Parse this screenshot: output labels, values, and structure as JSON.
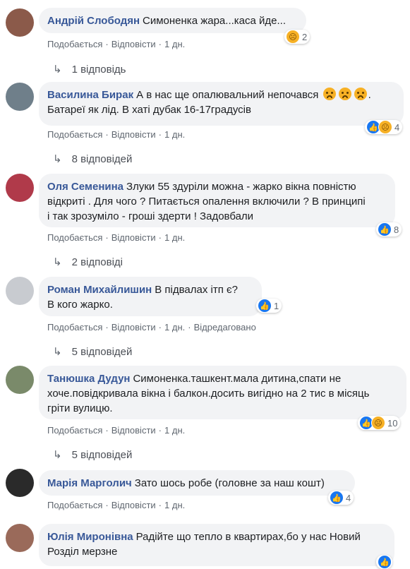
{
  "labels": {
    "like": "Подобається",
    "reply": "Відповісти",
    "edited": "Відредаговано"
  },
  "comments": [
    {
      "author": "Андрій Слободян",
      "text": "Симоненка жара...каса йде...",
      "reactions": "2",
      "time": "1 дн.",
      "replies": "1 відповідь",
      "avatar_color": "#8b5a4a"
    },
    {
      "author": "Василина Бирак",
      "text_line1": "А в нас ще опалювальний непочався",
      "text_line2": "Батареї як лід. В хаті дубак 16-17градусів",
      "reactions": "4",
      "time": "1 дн.",
      "replies": "8 відповідей",
      "avatar_color": "#6f7f8a"
    },
    {
      "author": "Оля Семенина",
      "text_line1": "Злуки 55 здуріли можна - жарко вікна повністю",
      "text_line2": "відкриті . Для чого ? Питається опалення включили ? В принципі",
      "text_line3": "і так зрозуміло - гроші здерти ! Задовбали",
      "reactions": "8",
      "time": "1 дн.",
      "replies": "2 відповіді",
      "avatar_color": "#b03a4a"
    },
    {
      "author": "Роман Михайлишин",
      "text_line1": "В підвалах ітп є?",
      "text_line2": "В кого жарко.",
      "reactions": "1",
      "time": "1 дн.",
      "replies": "5 відповідей",
      "avatar_color": "#c8cbd0"
    },
    {
      "author": "Танюшка Дудун",
      "text_line1": "Симоненка.ташкент.мала дитина,спати не",
      "text_line2": "хоче.повідкривала вікна і балкон.досить вигідно на 2 тис в місяць",
      "text_line3": "гріти вулицю.",
      "reactions": "10",
      "time": "1 дн.",
      "replies": "5 відповідей",
      "avatar_color": "#7a8a6a"
    },
    {
      "author": "Марія Марголич",
      "text": "Зато шось робе (головне за наш кошт)",
      "reactions": "4",
      "time": "1 дн.",
      "avatar_color": "#2a2a2a"
    },
    {
      "author": "Юлія Миронівна",
      "text_line1": "Радійте що тепло в квартирах,бо у нас Новий",
      "text_line2": "Розділ мерзне",
      "reactions": "",
      "avatar_color": "#9a6a5a"
    }
  ]
}
